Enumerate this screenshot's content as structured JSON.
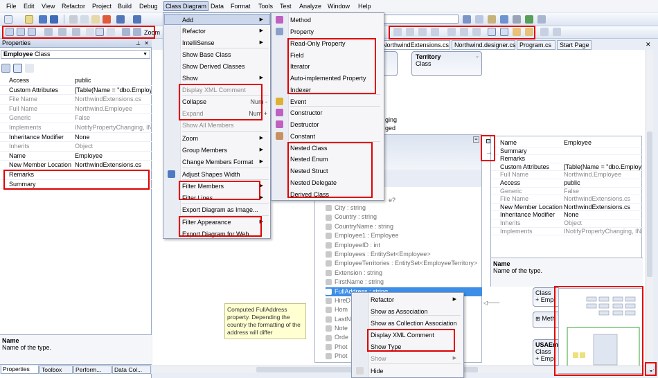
{
  "menubar": [
    "File",
    "Edit",
    "View",
    "Refactor",
    "Project",
    "Build",
    "Debug",
    "Class Diagram",
    "Data",
    "Format",
    "Tools",
    "Test",
    "Analyze",
    "Window",
    "Help"
  ],
  "toolbar": {
    "zoom_label": "Zoom"
  },
  "properties": {
    "title": "Properties",
    "object_name": "Employee",
    "object_kind": "Class",
    "rows": [
      {
        "k": "Access",
        "v": "public",
        "gray": false
      },
      {
        "k": "Custom Attributes",
        "v": "[Table(Name = \"dbo.Employ",
        "gray": false
      },
      {
        "k": "File Name",
        "v": "NorthwindExtensions.cs",
        "gray": true
      },
      {
        "k": "Full Name",
        "v": "Northwind.Employee",
        "gray": true
      },
      {
        "k": "Generic",
        "v": "False",
        "gray": true
      },
      {
        "k": "Implements",
        "v": "INotifyPropertyChanging, IN",
        "gray": true
      },
      {
        "k": "Inheritance Modifier",
        "v": "None",
        "gray": false
      },
      {
        "k": "Inherits",
        "v": "Object",
        "gray": true
      },
      {
        "k": "Name",
        "v": "Employee",
        "gray": false
      },
      {
        "k": "New Member Location",
        "v": "NorthwindExtensions.cs",
        "gray": false
      },
      {
        "k": "Remarks",
        "v": "",
        "gray": false
      },
      {
        "k": "Summary",
        "v": "",
        "gray": false
      }
    ],
    "desc_title": "Name",
    "desc_text": "Name of the type.",
    "tabs": [
      "Properties",
      "Toolbox",
      "Perform...",
      "Data Col..."
    ]
  },
  "doc_tabs": [
    "NorthwindExtensions.cs",
    "Northwind.designer.cs",
    "Program.cs",
    "Start Page"
  ],
  "class_menu": {
    "items": [
      {
        "label": "Add",
        "sub": true
      },
      {
        "label": "Refactor",
        "sub": true
      },
      {
        "label": "IntelliSense",
        "sub": true
      },
      {
        "label": "Show Base Class"
      },
      {
        "label": "Show Derived Classes"
      },
      {
        "label": "Show",
        "sub": true
      },
      {
        "label": "Display XML Comment",
        "dis": true
      },
      {
        "label": "Collapse",
        "sc": "Num -"
      },
      {
        "label": "Expand",
        "sc": "Num +",
        "dis": true
      },
      {
        "label": "Show All Members",
        "dis": true
      },
      {
        "label": "Zoom",
        "sub": true
      },
      {
        "label": "Group Members",
        "sub": true
      },
      {
        "label": "Change Members Format",
        "sub": true
      },
      {
        "label": "Adjust Shapes Width"
      },
      {
        "label": "Filter Members",
        "sub": true
      },
      {
        "label": "Filter Lines",
        "sub": true
      },
      {
        "label": "Export Diagram as Image..."
      },
      {
        "label": "Filter Appearance",
        "sub": true
      },
      {
        "label": "Export Diagram for Web..."
      }
    ]
  },
  "add_menu": {
    "items": [
      "Method",
      "Property",
      "Read-Only Property",
      "Field",
      "Iterator",
      "Auto-implemented Property",
      "Indexer",
      "Event",
      "Constructor",
      "Destructor",
      "Constant",
      "Nested Class",
      "Nested Enum",
      "Nested Struct",
      "Nested Delegate",
      "Derived Class"
    ]
  },
  "territory": {
    "title": "Territory",
    "kind": "Class"
  },
  "canvas_frag": [
    "ging",
    "ged"
  ],
  "members": [
    "City : string",
    "Country : string",
    "CountryName : string",
    "Employee1 : Employee",
    "EmployeeID : int",
    "Employees : EntitySet<Employee>",
    "EmployeeTerritories : EntitySet<EmployeeTerritory>",
    "Extension : string",
    "FirstName : string",
    "FullAddress : string",
    "HireD",
    "Hom",
    "LastN",
    "Note",
    "Orde",
    "Phot",
    "Phot"
  ],
  "member_partial": "e?",
  "details": {
    "rows": [
      {
        "k": "Name",
        "v": "Employee",
        "gray": false
      },
      {
        "k": "Summary",
        "v": "",
        "gray": false
      },
      {
        "k": "Remarks",
        "v": "",
        "gray": false
      },
      {
        "k": "Custom Attributes",
        "v": "[Table(Name = \"dbo.Employees\"",
        "gray": false
      },
      {
        "k": "Full Name",
        "v": "Northwind.Employee",
        "gray": true
      },
      {
        "k": "Access",
        "v": "public",
        "gray": false
      },
      {
        "k": "Generic",
        "v": "False",
        "gray": true
      },
      {
        "k": "File Name",
        "v": "NorthwindExtensions.cs",
        "gray": true
      },
      {
        "k": "New Member Location",
        "v": "NorthwindExtensions.cs",
        "gray": false
      },
      {
        "k": "Inheritance Modifier",
        "v": "None",
        "gray": false
      },
      {
        "k": "Inherits",
        "v": "Object",
        "gray": true
      },
      {
        "k": "Implements",
        "v": "INotifyPropertyChanging, INotifyP",
        "gray": true
      }
    ],
    "desc_title": "Name",
    "desc_text": "Name of the type."
  },
  "ctx_menu": {
    "items": [
      {
        "label": "Refactor",
        "sub": true
      },
      {
        "label": "Show as Association"
      },
      {
        "label": "Show as Collection Association"
      },
      {
        "label": "Display XML Comment"
      },
      {
        "label": "Show Type"
      },
      {
        "label": "Show",
        "sub": true,
        "dis": true
      },
      {
        "label": "Hide"
      }
    ]
  },
  "note": "Computed FullAddress property. Depending the country the formatting of the address will differ",
  "right_shapes": [
    {
      "kind": "Class",
      "line": "+ Empl"
    },
    {
      "line": "Meth"
    },
    {
      "title": "USAEm",
      "kind": "Class",
      "line": "+ Empl"
    }
  ]
}
